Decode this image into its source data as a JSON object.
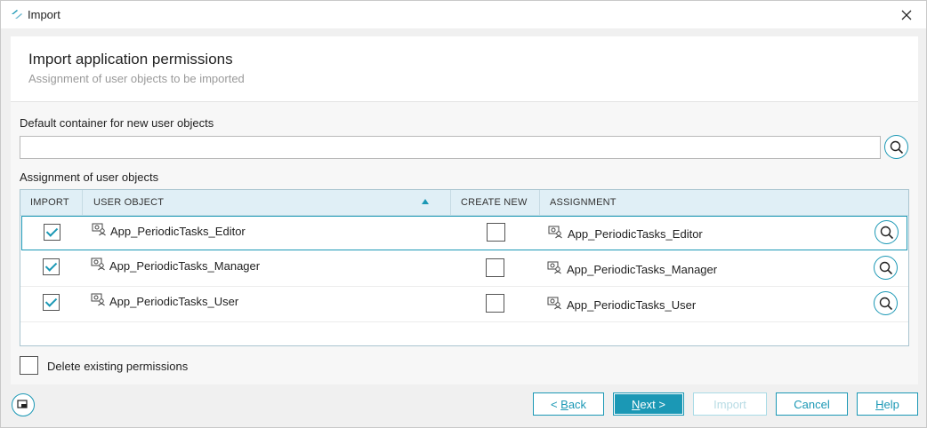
{
  "window": {
    "title": "Import",
    "app_icon": "app-logo-icon",
    "close_icon": "close-icon"
  },
  "header": {
    "title": "Import application permissions",
    "subtitle": "Assignment of user objects to be imported"
  },
  "container": {
    "label": "Default container for new user objects",
    "value": "",
    "placeholder": ""
  },
  "assignment": {
    "label": "Assignment of user objects",
    "columns": {
      "import": "IMPORT",
      "user_object": "USER OBJECT",
      "create_new": "CREATE NEW",
      "assignment": "ASSIGNMENT"
    },
    "sort": {
      "column": "USER OBJECT",
      "direction": "ascending"
    },
    "rows": [
      {
        "import": true,
        "user_object": "App_PeriodicTasks_Editor",
        "create_new": false,
        "assignment": "App_PeriodicTasks_Editor",
        "selected": true
      },
      {
        "import": true,
        "user_object": "App_PeriodicTasks_Manager",
        "create_new": false,
        "assignment": "App_PeriodicTasks_Manager",
        "selected": false
      },
      {
        "import": true,
        "user_object": "App_PeriodicTasks_User",
        "create_new": false,
        "assignment": "App_PeriodicTasks_User",
        "selected": false
      }
    ]
  },
  "delete_existing": {
    "label": "Delete existing permissions",
    "checked": false
  },
  "footer": {
    "back": {
      "mnemonic": "B",
      "before": "< ",
      "after": "ack"
    },
    "next": {
      "mnemonic": "N",
      "before": "",
      "after": "ext >"
    },
    "import": {
      "label": "Import",
      "enabled": false
    },
    "cancel": {
      "label": "Cancel"
    },
    "help": {
      "mnemonic": "H",
      "after": "elp"
    }
  },
  "colors": {
    "accent": "#1b98b5",
    "header_bg": "#e0eff6",
    "disabled": "#b7dbe4"
  }
}
